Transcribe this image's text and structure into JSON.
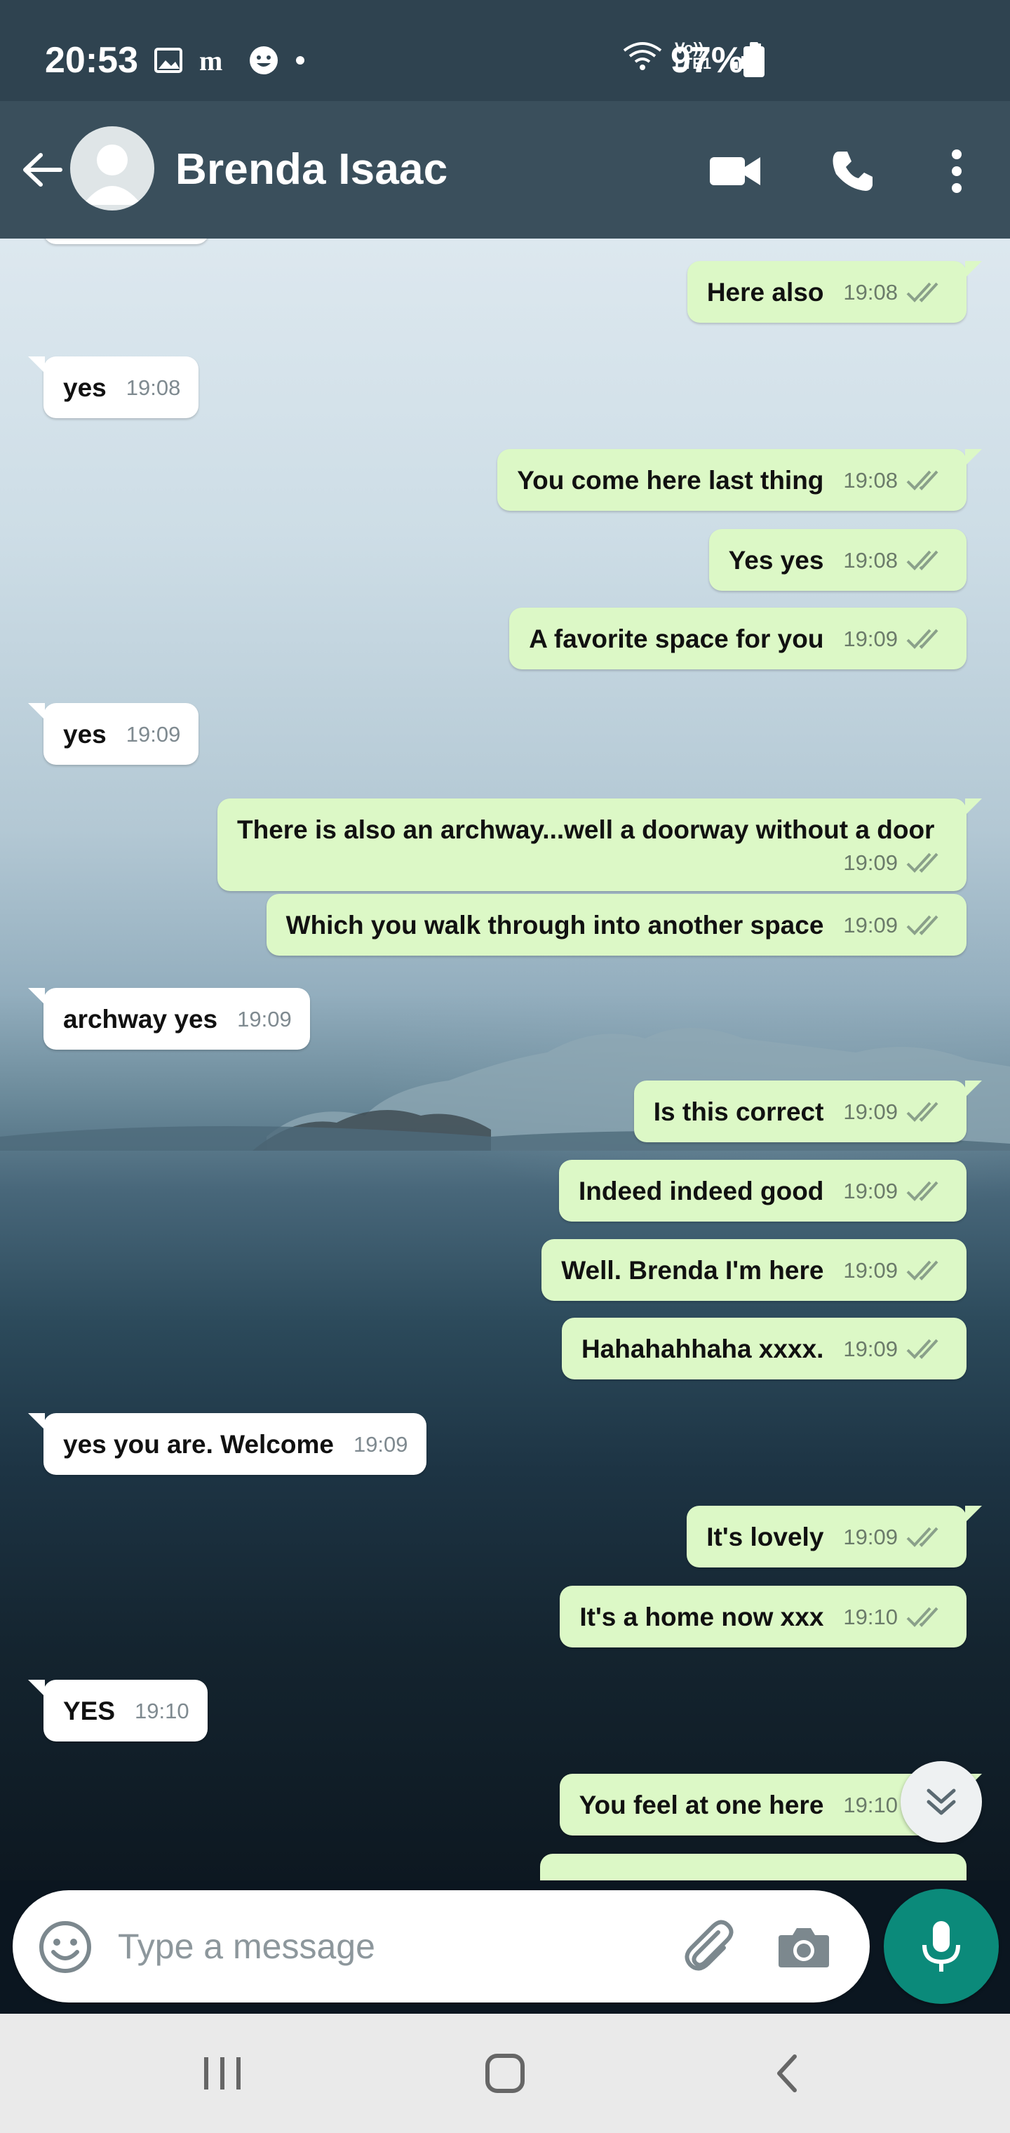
{
  "status_bar": {
    "time": "20:53",
    "notification_icons": [
      "gallery-icon",
      "m-icon",
      "face-icon",
      "dot-icon"
    ],
    "network_label": "Vo)) LTE1",
    "battery_percent": "97%"
  },
  "header": {
    "contact_name": "Brenda Isaac",
    "actions": [
      "video-call-icon",
      "voice-call-icon",
      "more-menu-icon"
    ]
  },
  "messages": [
    {
      "direction": "out",
      "text": "Here also",
      "time": "19:08",
      "status": "read"
    },
    {
      "direction": "in",
      "text": "yes",
      "time": "19:08"
    },
    {
      "direction": "out",
      "text": "You come here last thing",
      "time": "19:08",
      "status": "read"
    },
    {
      "direction": "out",
      "text": "Yes yes",
      "time": "19:08",
      "status": "read"
    },
    {
      "direction": "out",
      "text": "A favorite space for you",
      "time": "19:09",
      "status": "read"
    },
    {
      "direction": "in",
      "text": "yes",
      "time": "19:09"
    },
    {
      "direction": "out",
      "text": "There is also an archway...well a doorway without a door",
      "time": "19:09",
      "status": "read"
    },
    {
      "direction": "out",
      "text": "Which you walk through into another space",
      "time": "19:09",
      "status": "read"
    },
    {
      "direction": "in",
      "text": "archway yes",
      "time": "19:09"
    },
    {
      "direction": "out",
      "text": "Is this correct",
      "time": "19:09",
      "status": "read"
    },
    {
      "direction": "out",
      "text": "Indeed indeed good",
      "time": "19:09",
      "status": "read"
    },
    {
      "direction": "out",
      "text": "Well. Brenda I'm here",
      "time": "19:09",
      "status": "read"
    },
    {
      "direction": "out",
      "text": "Hahahahhaha xxxx.",
      "time": "19:09",
      "status": "read"
    },
    {
      "direction": "in",
      "text": "yes you are. Welcome",
      "time": "19:09"
    },
    {
      "direction": "out",
      "text": "It's lovely",
      "time": "19:09",
      "status": "read"
    },
    {
      "direction": "out",
      "text": "It's a home now xxx",
      "time": "19:10",
      "status": "read"
    },
    {
      "direction": "in",
      "text": "YES",
      "time": "19:10"
    },
    {
      "direction": "out",
      "text": "You feel at one here",
      "time": "19:10",
      "status": "read"
    }
  ],
  "composer": {
    "placeholder": "Type a message",
    "value": ""
  },
  "colors": {
    "header": "#3a4f5c",
    "status_bar": "#2f4350",
    "outgoing_bubble": "#dcf8c6",
    "incoming_bubble": "#ffffff",
    "mic_button": "#0b8a7a",
    "read_ticks": "#8aa08a"
  }
}
